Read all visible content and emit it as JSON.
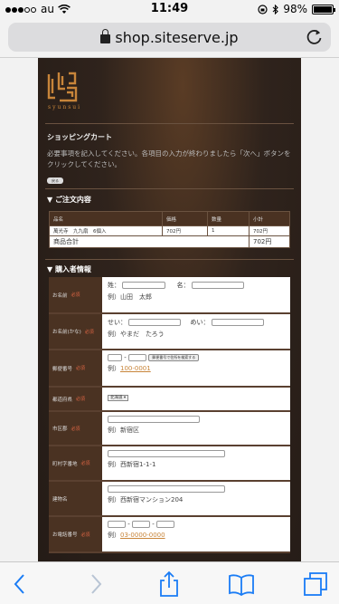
{
  "status_bar": {
    "carrier": "au",
    "time": "11:49",
    "battery": "98%",
    "battery_level": 0.98
  },
  "browser": {
    "url": "shop.siteserve.jp"
  },
  "site": {
    "logo_text": "syunsui",
    "cart_title": "ショッピングカート",
    "notice": "必要事項を記入してください。各項目の入力が終わりましたら「次へ」ボタンをクリックしてください。",
    "small_button": "戻る"
  },
  "order": {
    "section_title": "▼ ご注文内容",
    "headers": [
      "品名",
      "価格",
      "数量",
      "小計"
    ],
    "rows": [
      {
        "name": "萬光寺　九九扇　6個入",
        "price": "702円",
        "qty": "1",
        "subtotal": "702円"
      }
    ],
    "total_label": "商品合計",
    "total_value": "702円"
  },
  "buyer": {
    "section_title": "▼ 購入者情報",
    "required_mark": "必須",
    "name": {
      "label": "お名前",
      "sei": "姓：",
      "mei": "名：",
      "example": "例）山田　太郎"
    },
    "kana": {
      "label": "お名前(かな)",
      "sei": "せい：",
      "mei": "めい：",
      "example": "例）やまだ　たろう"
    },
    "zip": {
      "label": "郵便番号",
      "button": "郵便番号で住所を検索する",
      "example_prefix": "例）",
      "example_link": "100-0001"
    },
    "pref": {
      "label": "都道府県",
      "selected": "北海道"
    },
    "city": {
      "label": "市区郡",
      "example": "例）新宿区"
    },
    "town": {
      "label": "町村字番地",
      "example": "例）西新宿1-1-1"
    },
    "building": {
      "label": "建物名",
      "example": "例）西新宿マンション204"
    },
    "phone": {
      "label": "お電話番号",
      "example_prefix": "例）",
      "example_link": "03-0000-0000"
    }
  },
  "icons": [
    "back-icon",
    "forward-icon",
    "share-icon",
    "bookmarks-icon",
    "tabs-icon",
    "reload-icon",
    "lock-icon",
    "wifi-icon",
    "bluetooth-icon",
    "battery-icon"
  ]
}
